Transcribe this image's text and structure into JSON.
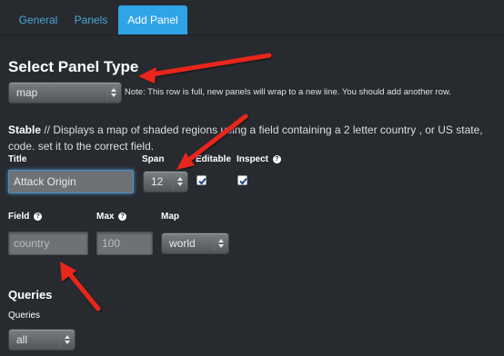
{
  "tabs": [
    {
      "label": "General"
    },
    {
      "label": "Panels"
    },
    {
      "label": "Add Panel"
    }
  ],
  "select_panel_type": {
    "title": "Select Panel Type",
    "value": "map",
    "note": "Note: This row is full, new panels will wrap to a new line. You should add another row."
  },
  "panel_description": {
    "name": "Stable",
    "text": " // Displays a map of shaded regions using a field containing a 2 letter country , or US state, code. set it to the correct field."
  },
  "fields": {
    "title_label": "Title",
    "title_value": "Attack Origin",
    "span_label": "Span",
    "span_value": "12",
    "editable_label": "Editable",
    "editable_checked": true,
    "inspect_label": "Inspect",
    "field_label": "Field",
    "field_placeholder": "country",
    "max_label": "Max",
    "max_placeholder": "100",
    "map_label": "Map",
    "map_value": "world",
    "help_glyph": "?"
  },
  "queries": {
    "section_title": "Queries",
    "label": "Queries",
    "value": "all"
  },
  "colors": {
    "background": "#272b30",
    "accent": "#2fa4e7",
    "annotation_arrow": "#e8261a"
  },
  "icons": [
    "caret-updown-icon",
    "checkmark-icon",
    "help-icon",
    "annotation-arrow-icon"
  ]
}
